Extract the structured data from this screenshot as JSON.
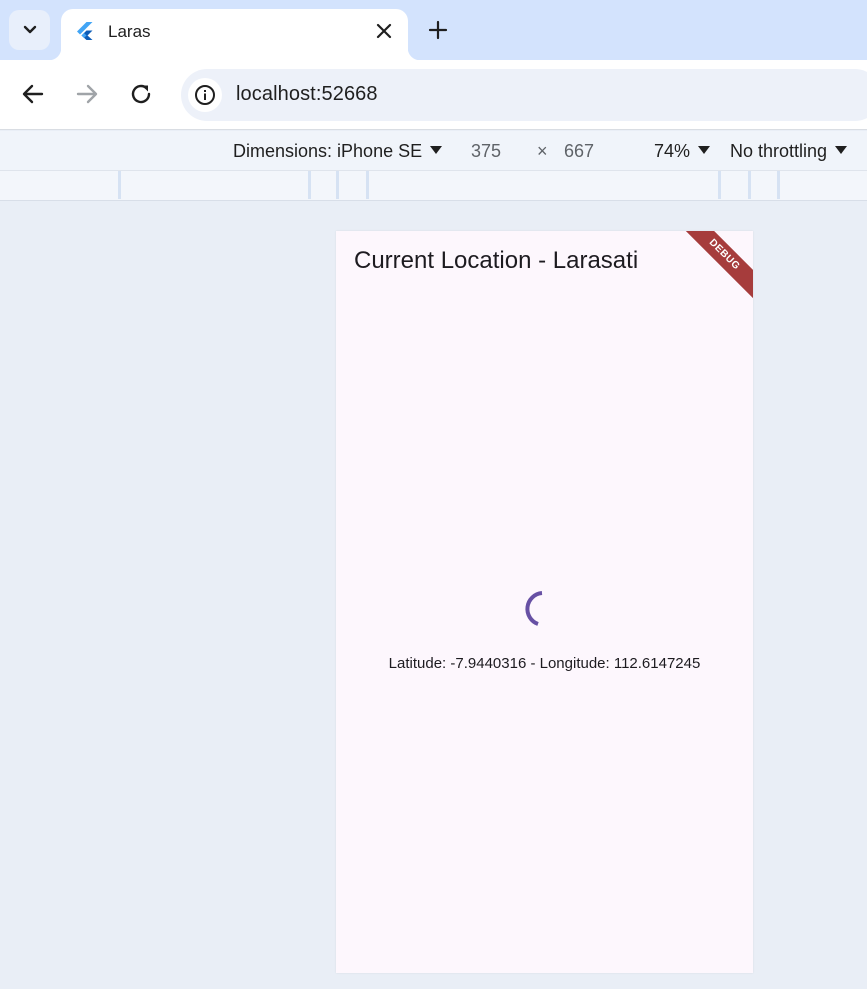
{
  "browser": {
    "tab": {
      "title": "Laras",
      "favicon": "flutter-logo-icon"
    },
    "omnibox": {
      "url": "localhost:52668"
    }
  },
  "device_toolbar": {
    "dimensions_label": "Dimensions: iPhone SE",
    "width": "375",
    "times": "×",
    "height": "667",
    "zoom": "74%",
    "throttling": "No throttling"
  },
  "app": {
    "title": "Current Location - Larasati",
    "debug_banner": "DEBUG",
    "location_text": "Latitude: -7.9440316 - Longitude: 112.6147245"
  },
  "colors": {
    "tabstrip": "#d3e3fd",
    "app_background": "#fdf7fd",
    "spinner": "#6750a4",
    "debug_banner": "#a63c3c"
  }
}
